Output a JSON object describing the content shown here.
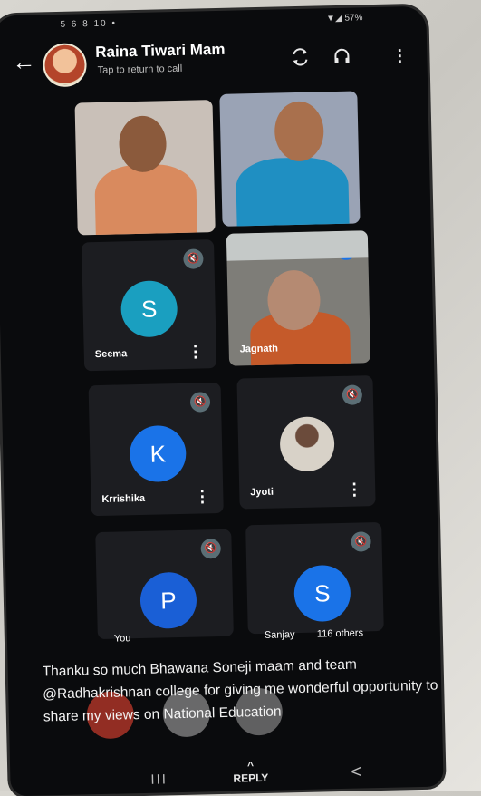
{
  "header": {
    "title": "Raina Tiwari Mam",
    "subtitle": "Tap to return to call",
    "status_left": "5 6 8 10 •",
    "status_right": "▼◢ 57%"
  },
  "participants": [
    {
      "name": "",
      "type": "video"
    },
    {
      "name": "",
      "type": "video"
    },
    {
      "name": "Seema",
      "type": "avatar",
      "initial": "S",
      "color": "#1a9fc0"
    },
    {
      "name": "Jagnath",
      "type": "video"
    },
    {
      "name": "Krrishika",
      "type": "avatar",
      "initial": "K",
      "color": "#1a73e8"
    },
    {
      "name": "Jyoti",
      "type": "photo"
    },
    {
      "name": "You",
      "type": "avatar",
      "initial": "P",
      "color": "#1a5fd6"
    },
    {
      "name": "Sanjay",
      "type": "avatar",
      "initial": "S",
      "color": "#1a73e8"
    }
  ],
  "others_label": "116 others",
  "notification": {
    "text": "Thanku so much Bhawana Soneji maam and team @Radhakrishnan college for giving me wonderful opportunity to share my views on National Education"
  },
  "navbar": {
    "recents": "III",
    "reply": "REPLY",
    "reply_arrow": "^",
    "back": "<"
  },
  "icons": {
    "back": "arrow-left",
    "switch_camera": "camera-switch",
    "audio": "headphones",
    "more": "kebab"
  }
}
